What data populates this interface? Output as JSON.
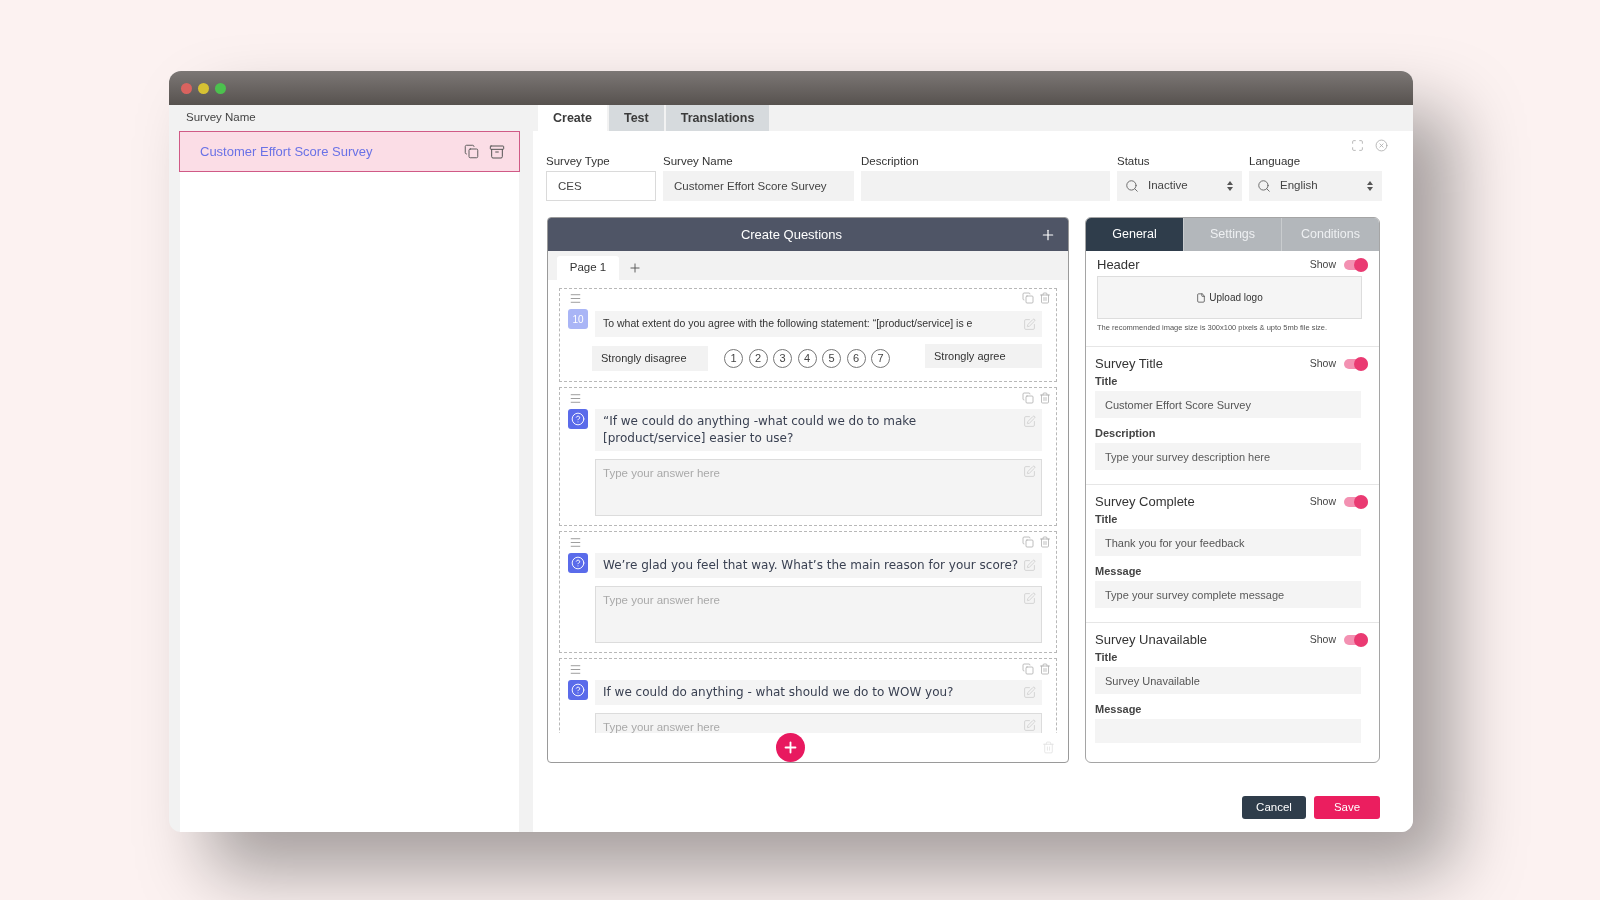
{
  "sidebar": {
    "heading": "Survey Name",
    "items": [
      {
        "name": "Customer Effort Score Survey",
        "selected": true
      }
    ]
  },
  "tabs": [
    {
      "label": "Create",
      "selected": true
    },
    {
      "label": "Test",
      "selected": false
    },
    {
      "label": "Translations",
      "selected": false
    }
  ],
  "form": {
    "fields": [
      {
        "kind": "outlined",
        "label": "Survey Type",
        "value": "CES"
      },
      {
        "kind": "filled",
        "label": "Survey Name",
        "value": "Customer Effort Score Survey"
      },
      {
        "kind": "filled",
        "label": "Description"
      },
      {
        "kind": "select",
        "label": "Status",
        "value": "Inactive"
      },
      {
        "kind": "select",
        "label": "Language",
        "value": "English"
      }
    ]
  },
  "questions_panel": {
    "title": "Create Questions",
    "pages": [
      {
        "label": "Page 1",
        "selected": true
      }
    ],
    "questions": [
      {
        "kind": "scale",
        "badge": "10",
        "text": "To what extent do you agree with the following statement: “[product/service] is e",
        "low_label": "Strongly disagree",
        "high_label": "Strongly agree",
        "options": [
          "1",
          "2",
          "3",
          "4",
          "5",
          "6",
          "7"
        ]
      },
      {
        "kind": "open",
        "text": "“If we could do anything -what could we do to make [product/service] easier to use?",
        "placeholder": "Type your answer here"
      },
      {
        "kind": "open",
        "text": "We’re glad you feel that way. What’s the main reason for your score?",
        "placeholder": "Type your answer here"
      },
      {
        "kind": "open",
        "text": "If we could do anything - what should we do to WOW you?",
        "placeholder": "Type your answer here"
      }
    ]
  },
  "settings_panel": {
    "tabs": [
      {
        "label": "General",
        "selected": true
      },
      {
        "label": "Settings",
        "selected": false
      },
      {
        "label": "Conditions",
        "selected": false
      }
    ],
    "sections": [
      {
        "kind": "logo",
        "title": "Header",
        "show_label": "Show",
        "on": true,
        "upload_label": "Upload logo",
        "note": "The recommended image size is 300x100 pixels & upto 5mb file size."
      },
      {
        "kind": "fields",
        "title": "Survey Title",
        "show_label": "Show",
        "on": true,
        "fields": [
          {
            "label": "Title",
            "value": "Customer Effort Score Survey"
          },
          {
            "label": "Description",
            "placeholder": "Type your survey description here"
          }
        ]
      },
      {
        "kind": "fields",
        "title": "Survey Complete",
        "show_label": "Show",
        "on": true,
        "fields": [
          {
            "label": "Title",
            "value": "Thank you for your feedback"
          },
          {
            "label": "Message",
            "placeholder": "Type your survey complete message"
          }
        ]
      },
      {
        "kind": "fields",
        "title": "Survey Unavailable",
        "show_label": "Show",
        "on": true,
        "fields": [
          {
            "label": "Title",
            "value": "Survey Unavailable"
          },
          {
            "label": "Message"
          }
        ]
      }
    ]
  },
  "actions": [
    {
      "kind": "secondary",
      "label": "Cancel"
    },
    {
      "kind": "primary",
      "label": "Save"
    }
  ]
}
